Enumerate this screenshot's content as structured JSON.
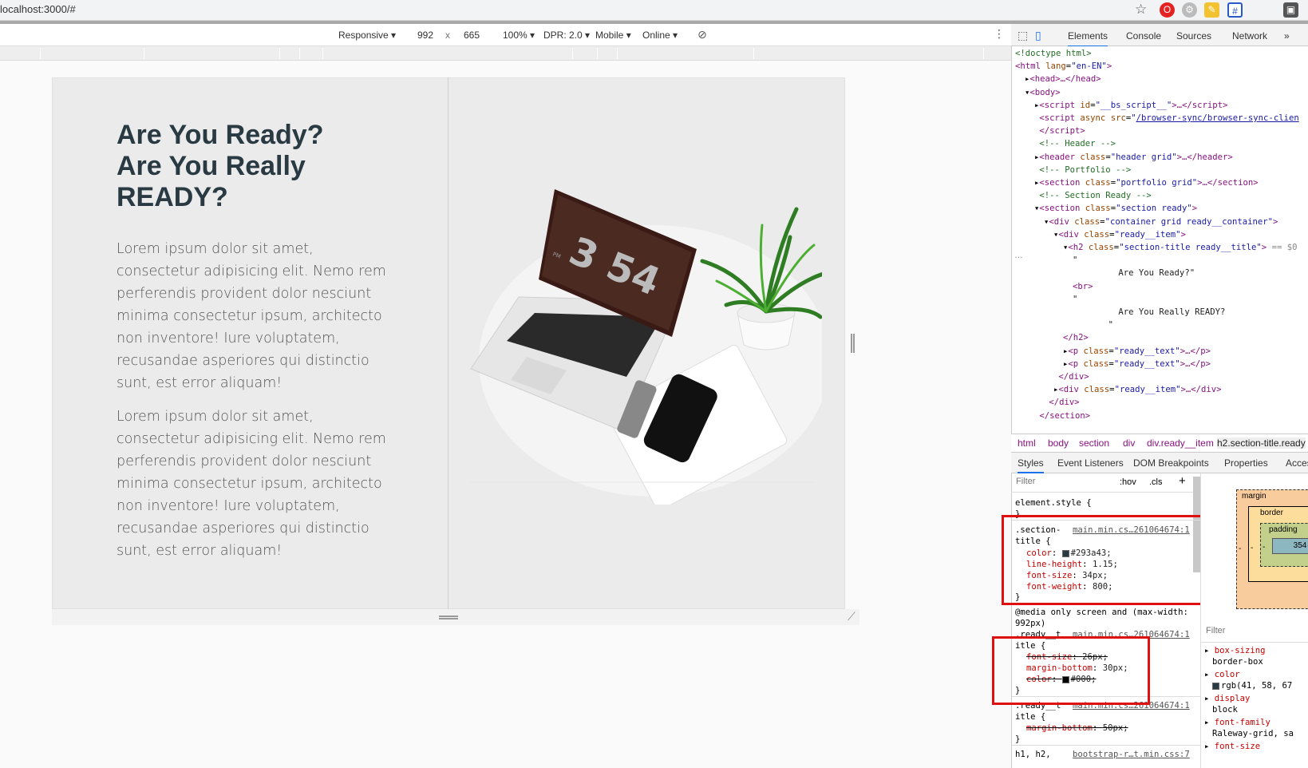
{
  "browser": {
    "url": "localhost:3000/#"
  },
  "device_toolbar": {
    "mode": "Responsive",
    "width": "992",
    "times": "x",
    "height": "665",
    "zoom": "100%",
    "dpr": "DPR: 2.0",
    "device_type": "Mobile",
    "network": "Online"
  },
  "page": {
    "title_line1": "Are You Ready?",
    "title_line2": "Are You Really",
    "title_line3": "READY?",
    "paragraph1": "Lorem ipsum dolor sit amet, consectetur adipisicing elit. Nemo rem perferendis provident dolor nesciunt minima consectetur ipsum, architecto non inventore! Iure voluptatem, recusandae asperiores qui distinctio sunt, est error aliquam!",
    "paragraph2": "Lorem ipsum dolor sit amet, consectetur adipisicing elit. Nemo rem perferendis provident dolor nesciunt minima consectetur ipsum, architecto non inventore! Iure voluptatem, recusandae asperiores qui distinctio sunt, est error aliquam!",
    "laptop_screen_text": "3 54",
    "laptop_screen_small": "PM"
  },
  "devtools": {
    "tabs": [
      "Elements",
      "Console",
      "Sources",
      "Network"
    ],
    "more": "»",
    "elements": [
      {
        "indent": 0,
        "html": "<span class='cm'>&lt;!doctype html&gt;</span>"
      },
      {
        "indent": 0,
        "html": "<span class='tg'>&lt;html </span><span class='at'>lang</span>=<span class='av'>\"en-EN\"</span><span class='tg'>&gt;</span>"
      },
      {
        "indent": 1,
        "html": "▸<span class='tg'>&lt;head&gt;…&lt;/head&gt;</span>"
      },
      {
        "indent": 1,
        "html": "▾<span class='tg'>&lt;body&gt;</span>"
      },
      {
        "indent": 2,
        "html": "▸<span class='tg'>&lt;script </span><span class='at'>id</span>=<span class='av'>\"__bs_script__\"</span><span class='tg'>&gt;…&lt;/script&gt;</span>"
      },
      {
        "indent": 2,
        "html": "&nbsp;<span class='tg'>&lt;script </span><span class='at'>async src</span>=<span class='av'>\"<u>/browser-sync/browser-sync-clien</u></span>"
      },
      {
        "indent": 2,
        "html": "&nbsp;<span class='tg'>&lt;/script&gt;</span>"
      },
      {
        "indent": 2,
        "html": "&nbsp;<span class='cm'>&lt;!-- Header --&gt;</span>"
      },
      {
        "indent": 2,
        "html": "▸<span class='tg'>&lt;header </span><span class='at'>class</span>=<span class='av'>\"header grid\"</span><span class='tg'>&gt;…&lt;/header&gt;</span>"
      },
      {
        "indent": 2,
        "html": "&nbsp;<span class='cm'>&lt;!-- Portfolio --&gt;</span>"
      },
      {
        "indent": 2,
        "html": "▸<span class='tg'>&lt;section </span><span class='at'>class</span>=<span class='av'>\"portfolio grid\"</span><span class='tg'>&gt;…&lt;/section&gt;</span>"
      },
      {
        "indent": 2,
        "html": "&nbsp;<span class='cm'>&lt;!-- Section Ready --&gt;</span>"
      },
      {
        "indent": 2,
        "html": "▾<span class='tg'>&lt;section </span><span class='at'>class</span>=<span class='av'>\"section ready\"</span><span class='tg'>&gt;</span>"
      },
      {
        "indent": 3,
        "html": "▾<span class='tg'>&lt;div </span><span class='at'>class</span>=<span class='av'>\"container grid ready__container\"</span><span class='tg'>&gt;</span>"
      },
      {
        "indent": 4,
        "html": "▾<span class='tg'>&lt;div </span><span class='at'>class</span>=<span class='av'>\"ready__item\"</span><span class='tg'>&gt;</span>"
      },
      {
        "indent": 5,
        "html": "▾<span class='tg'>&lt;h2 </span><span class='at'>class</span>=<span class='av'>\"section-title ready__title\"</span><span class='tg'>&gt;</span> <span style='color:#888'>== $0</span>"
      },
      {
        "indent": 6,
        "html": "<span class='tx'>\"</span>"
      },
      {
        "indent": 6,
        "html": "<span class='tx'>&nbsp;&nbsp;&nbsp;&nbsp;&nbsp;&nbsp;&nbsp;&nbsp;&nbsp;Are You Ready?\"</span>"
      },
      {
        "indent": 6,
        "html": "<span class='tg'>&lt;br&gt;</span>"
      },
      {
        "indent": 6,
        "html": "<span class='tx'>\"</span>"
      },
      {
        "indent": 6,
        "html": "<span class='tx'>&nbsp;&nbsp;&nbsp;&nbsp;&nbsp;&nbsp;&nbsp;&nbsp;&nbsp;Are You Really READY?</span>"
      },
      {
        "indent": 6,
        "html": "<span class='tx'>&nbsp;&nbsp;&nbsp;&nbsp;&nbsp;&nbsp;&nbsp;\"</span>"
      },
      {
        "indent": 5,
        "html": "<span class='tg'>&lt;/h2&gt;</span>"
      },
      {
        "indent": 5,
        "html": "▸<span class='tg'>&lt;p </span><span class='at'>class</span>=<span class='av'>\"ready__text\"</span><span class='tg'>&gt;…&lt;/p&gt;</span>"
      },
      {
        "indent": 5,
        "html": "▸<span class='tg'>&lt;p </span><span class='at'>class</span>=<span class='av'>\"ready__text\"</span><span class='tg'>&gt;…&lt;/p&gt;</span>"
      },
      {
        "indent": 4,
        "html": "&nbsp;<span class='tg'>&lt;/div&gt;</span>"
      },
      {
        "indent": 4,
        "html": "▸<span class='tg'>&lt;div </span><span class='at'>class</span>=<span class='av'>\"ready__item\"</span><span class='tg'>&gt;…&lt;/div&gt;</span>"
      },
      {
        "indent": 3,
        "html": "&nbsp;<span class='tg'>&lt;/div&gt;</span>"
      },
      {
        "indent": 2,
        "html": "&nbsp;<span class='tg'>&lt;/section&gt;</span>"
      }
    ],
    "breadcrumbs": [
      "html",
      "body",
      "section",
      "div",
      "div.ready__item",
      "h2.section-title.ready"
    ],
    "subtabs": [
      "Styles",
      "Event Listeners",
      "DOM Breakpoints",
      "Properties",
      "Acces"
    ],
    "filter_placeholder": "Filter",
    "hov": ":hov",
    "cls": ".cls",
    "plus": "+",
    "styles": {
      "element_style": "element.style {",
      "rule1_selector": ".section-\ntitle {",
      "rule1_source": "main.min.cs…261064674:1",
      "rule1_props": [
        {
          "name": "color",
          "value": "#293a43;",
          "swatch": "#293a43"
        },
        {
          "name": "line-height",
          "value": "1.15;"
        },
        {
          "name": "font-size",
          "value": "34px;"
        },
        {
          "name": "font-weight",
          "value": "800;"
        }
      ],
      "media": "@media only screen and (max-width: 992px)",
      "rule2_selector": ".ready__t\nitle {",
      "rule2_source": "main.min.cs…261064674:1",
      "rule2_props": [
        {
          "name": "font-size",
          "value": "26px;",
          "struck": true
        },
        {
          "name": "margin-bottom",
          "value": "30px;"
        },
        {
          "name": "color",
          "value": "#000;",
          "swatch": "#000000",
          "struck": true
        }
      ],
      "rule3_selector": ".ready__t\nitle {",
      "rule3_source": "main.min.cs…261064674:1",
      "rule3_props": [
        {
          "name": "margin-bottom",
          "value": "50px;",
          "struck": true
        }
      ],
      "rule4": "h1, h2,",
      "rule4_source": "bootstrap-r…t.min.css:7"
    },
    "boxmodel": {
      "margin": "margin",
      "border": "border",
      "padding": "padding",
      "content": "354",
      "dash": "-"
    },
    "computed": {
      "filter": "Filter",
      "items": [
        {
          "name": "box-sizing",
          "value": "border-box"
        },
        {
          "name": "color",
          "value": "rgb(41, 58, 67",
          "swatch": "#293a43"
        },
        {
          "name": "display",
          "value": "block"
        },
        {
          "name": "font-family",
          "value": "Raleway-grid, sa"
        },
        {
          "name": "font-size",
          "value": ""
        }
      ]
    }
  }
}
